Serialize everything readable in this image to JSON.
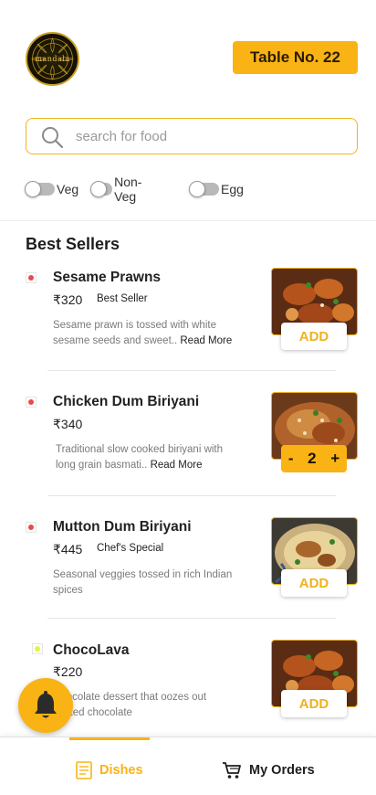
{
  "header": {
    "logo_text": "mandala",
    "table_label": "Table No. 22"
  },
  "search": {
    "placeholder": "search for food",
    "value": ""
  },
  "filters": [
    {
      "label": "Veg",
      "on": false
    },
    {
      "label": "Non-Veg",
      "on": false
    },
    {
      "label": "Egg",
      "on": false
    }
  ],
  "section_title": "Best Sellers",
  "items": [
    {
      "name": "Sesame Prawns",
      "price": "₹320",
      "tag": "Best Seller",
      "desc": "Sesame prawn is tossed with white sesame seeds and sweet..",
      "read_more": "Read More",
      "type": "non-veg",
      "action": "ADD"
    },
    {
      "name": "Chicken Dum Biriyani",
      "price": "₹340",
      "tag": "",
      "desc": "Traditional slow cooked biriyani with long grain basmati..",
      "read_more": "Read More",
      "type": "non-veg",
      "quantity": "2",
      "minus": "-",
      "plus": "+"
    },
    {
      "name": "Mutton Dum Biriyani",
      "price": "₹445",
      "tag": "Chef's Special",
      "desc": "Seasonal veggies tossed in rich Indian spices",
      "read_more": "",
      "type": "non-veg",
      "action": "ADD"
    },
    {
      "name": "ChocoLava",
      "price": "₹220",
      "tag": "",
      "desc": "Chocolate dessert that oozes out melted chocolate",
      "read_more": "",
      "type": "egg",
      "action": "ADD"
    }
  ],
  "bottom_nav": {
    "dishes_label": "Dishes",
    "orders_label": "My Orders"
  },
  "colors": {
    "accent": "#f9b315",
    "non_veg_dot": "#e84a4a",
    "egg_dot": "#e5f53a"
  },
  "icons": [
    "search-icon",
    "bell-icon",
    "menu-book-icon",
    "cart-icon"
  ]
}
